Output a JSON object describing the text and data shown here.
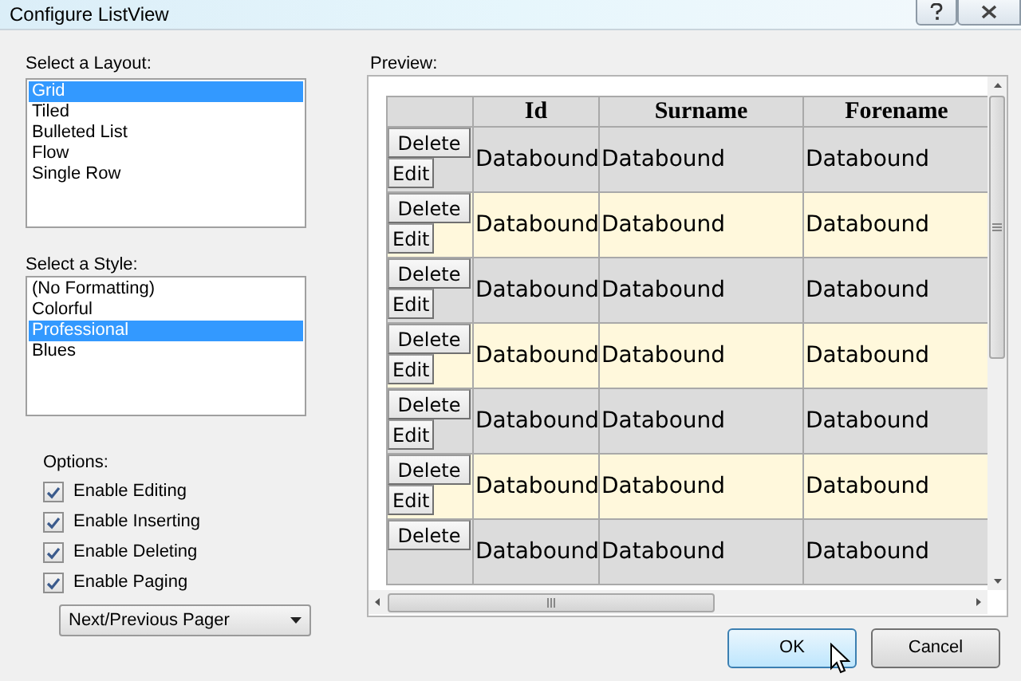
{
  "window": {
    "title": "Configure ListView"
  },
  "layout_list": {
    "label": "Select a Layout:",
    "items": [
      {
        "label": "Grid",
        "selected": true
      },
      {
        "label": "Tiled",
        "selected": false
      },
      {
        "label": "Bulleted List",
        "selected": false
      },
      {
        "label": "Flow",
        "selected": false
      },
      {
        "label": "Single Row",
        "selected": false
      }
    ]
  },
  "style_list": {
    "label": "Select a Style:",
    "items": [
      {
        "label": "(No Formatting)",
        "selected": false
      },
      {
        "label": "Colorful",
        "selected": false
      },
      {
        "label": "Professional",
        "selected": true
      },
      {
        "label": "Blues",
        "selected": false
      }
    ]
  },
  "options": {
    "label": "Options:",
    "items": [
      {
        "label": "Enable Editing",
        "checked": true
      },
      {
        "label": "Enable Inserting",
        "checked": true
      },
      {
        "label": "Enable Deleting",
        "checked": true
      },
      {
        "label": "Enable Paging",
        "checked": true
      }
    ]
  },
  "pager": {
    "value": "Next/Previous Pager"
  },
  "preview": {
    "label": "Preview:",
    "columns": [
      "Id",
      "Surname",
      "Forename"
    ],
    "rows": [
      {
        "buttons": [
          "Delete",
          "Edit"
        ],
        "cells": [
          "Databound",
          "Databound",
          "Databound"
        ]
      },
      {
        "buttons": [
          "Delete",
          "Edit"
        ],
        "cells": [
          "Databound",
          "Databound",
          "Databound"
        ]
      },
      {
        "buttons": [
          "Delete",
          "Edit"
        ],
        "cells": [
          "Databound",
          "Databound",
          "Databound"
        ]
      },
      {
        "buttons": [
          "Delete",
          "Edit"
        ],
        "cells": [
          "Databound",
          "Databound",
          "Databound"
        ]
      },
      {
        "buttons": [
          "Delete",
          "Edit"
        ],
        "cells": [
          "Databound",
          "Databound",
          "Databound"
        ]
      },
      {
        "buttons": [
          "Delete",
          "Edit"
        ],
        "cells": [
          "Databound",
          "Databound",
          "Databound"
        ]
      },
      {
        "buttons": [
          "Delete"
        ],
        "cells": [
          "Databound",
          "Databound",
          "Databound"
        ]
      }
    ]
  },
  "buttons": [
    {
      "label": "OK",
      "default": true
    },
    {
      "label": "Cancel",
      "default": false
    }
  ]
}
